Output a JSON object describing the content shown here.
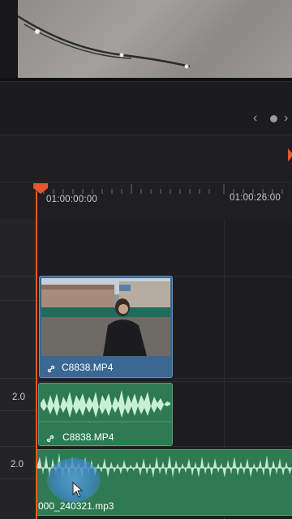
{
  "viewer": {
    "description_icon": "video-preview"
  },
  "toolbar": {
    "prev_glyph": "‹",
    "next_glyph": "›"
  },
  "ruler": {
    "timecode_start": "01:00:00:00",
    "timecode_end": "01:00:26:00"
  },
  "tracks": {
    "video": {
      "clip_name": "C8838.MP4"
    },
    "audio1": {
      "volume": "2.0",
      "clip_name": "C8838.MP4"
    },
    "audio2": {
      "volume": "2.0",
      "clip_name": "000_240321.mp3"
    }
  },
  "colors": {
    "playhead": "#e8552f",
    "video_clip": "#3b6793",
    "audio_clip": "#2f7a52",
    "waveform": "#c9f0d6"
  }
}
